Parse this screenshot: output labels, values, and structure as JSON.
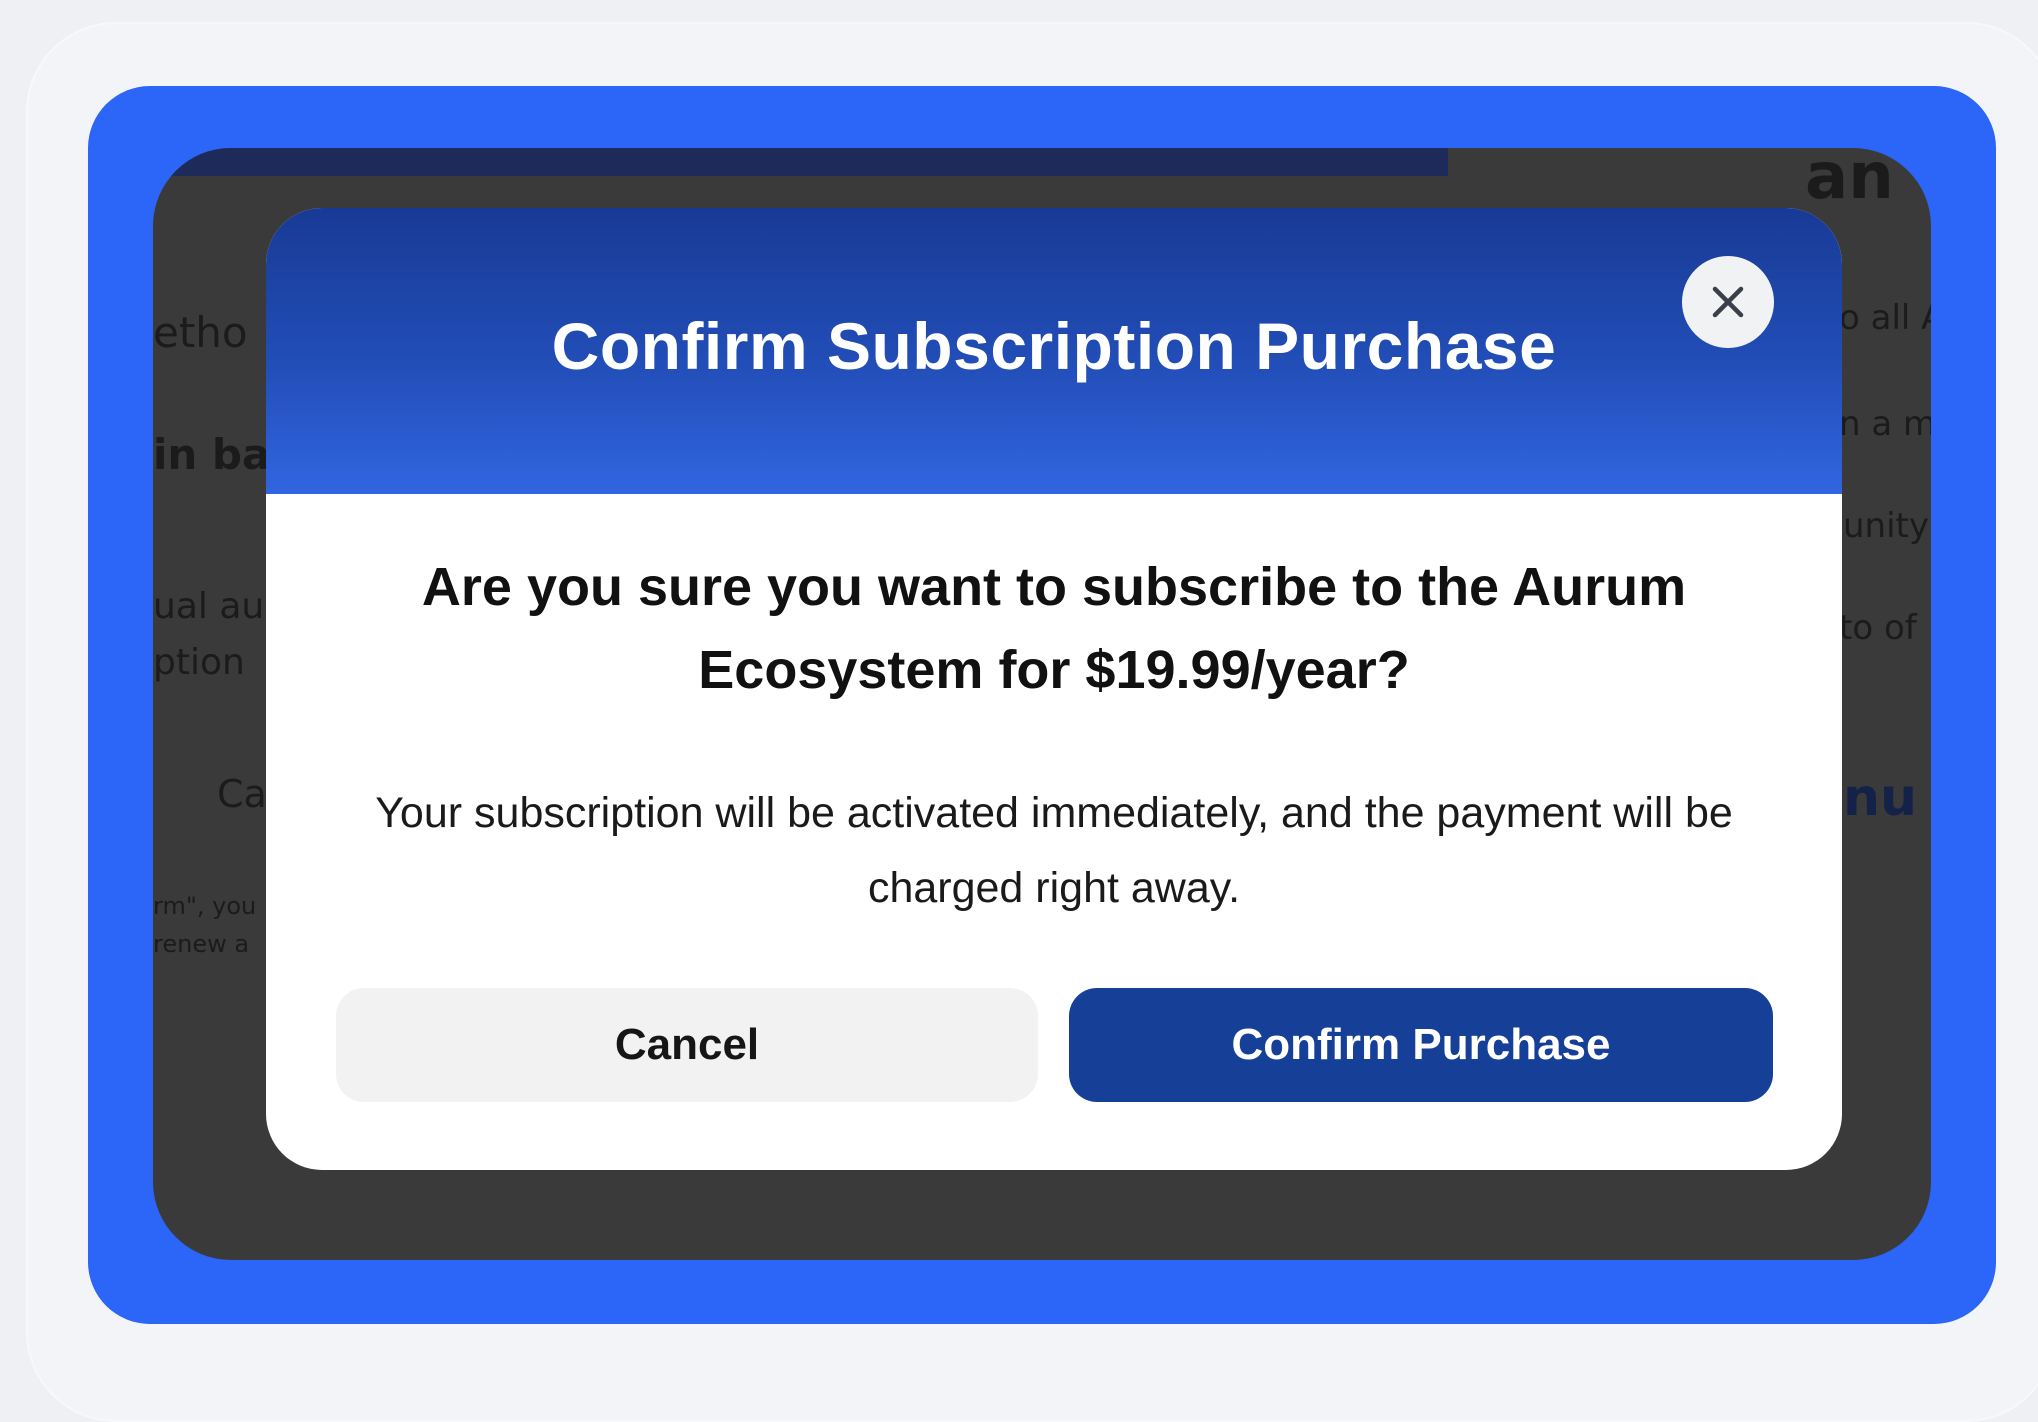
{
  "background": {
    "left_fragments": [
      "etho",
      "in ba",
      "ual au",
      "ption",
      "Ca",
      "rm\", you",
      "renew a"
    ],
    "right_fragments": [
      "an",
      "o all A",
      "n a m",
      "unity",
      "to of",
      "nu"
    ]
  },
  "modal": {
    "title": "Confirm Subscription Purchase",
    "close_icon": "close-icon",
    "question": "Are you sure you want to subscribe to the Aurum Ecosystem for $19.99/year?",
    "detail": "Your subscription will be activated immediately, and the payment will be charged right away.",
    "cancel_label": "Cancel",
    "confirm_label": "Confirm Purchase"
  },
  "colors": {
    "frame_blue": "#2b66f8",
    "header_gradient_top": "#183a95",
    "header_gradient_bottom": "#3165e1",
    "confirm_button": "#163f98",
    "cancel_button": "#f2f2f3"
  }
}
